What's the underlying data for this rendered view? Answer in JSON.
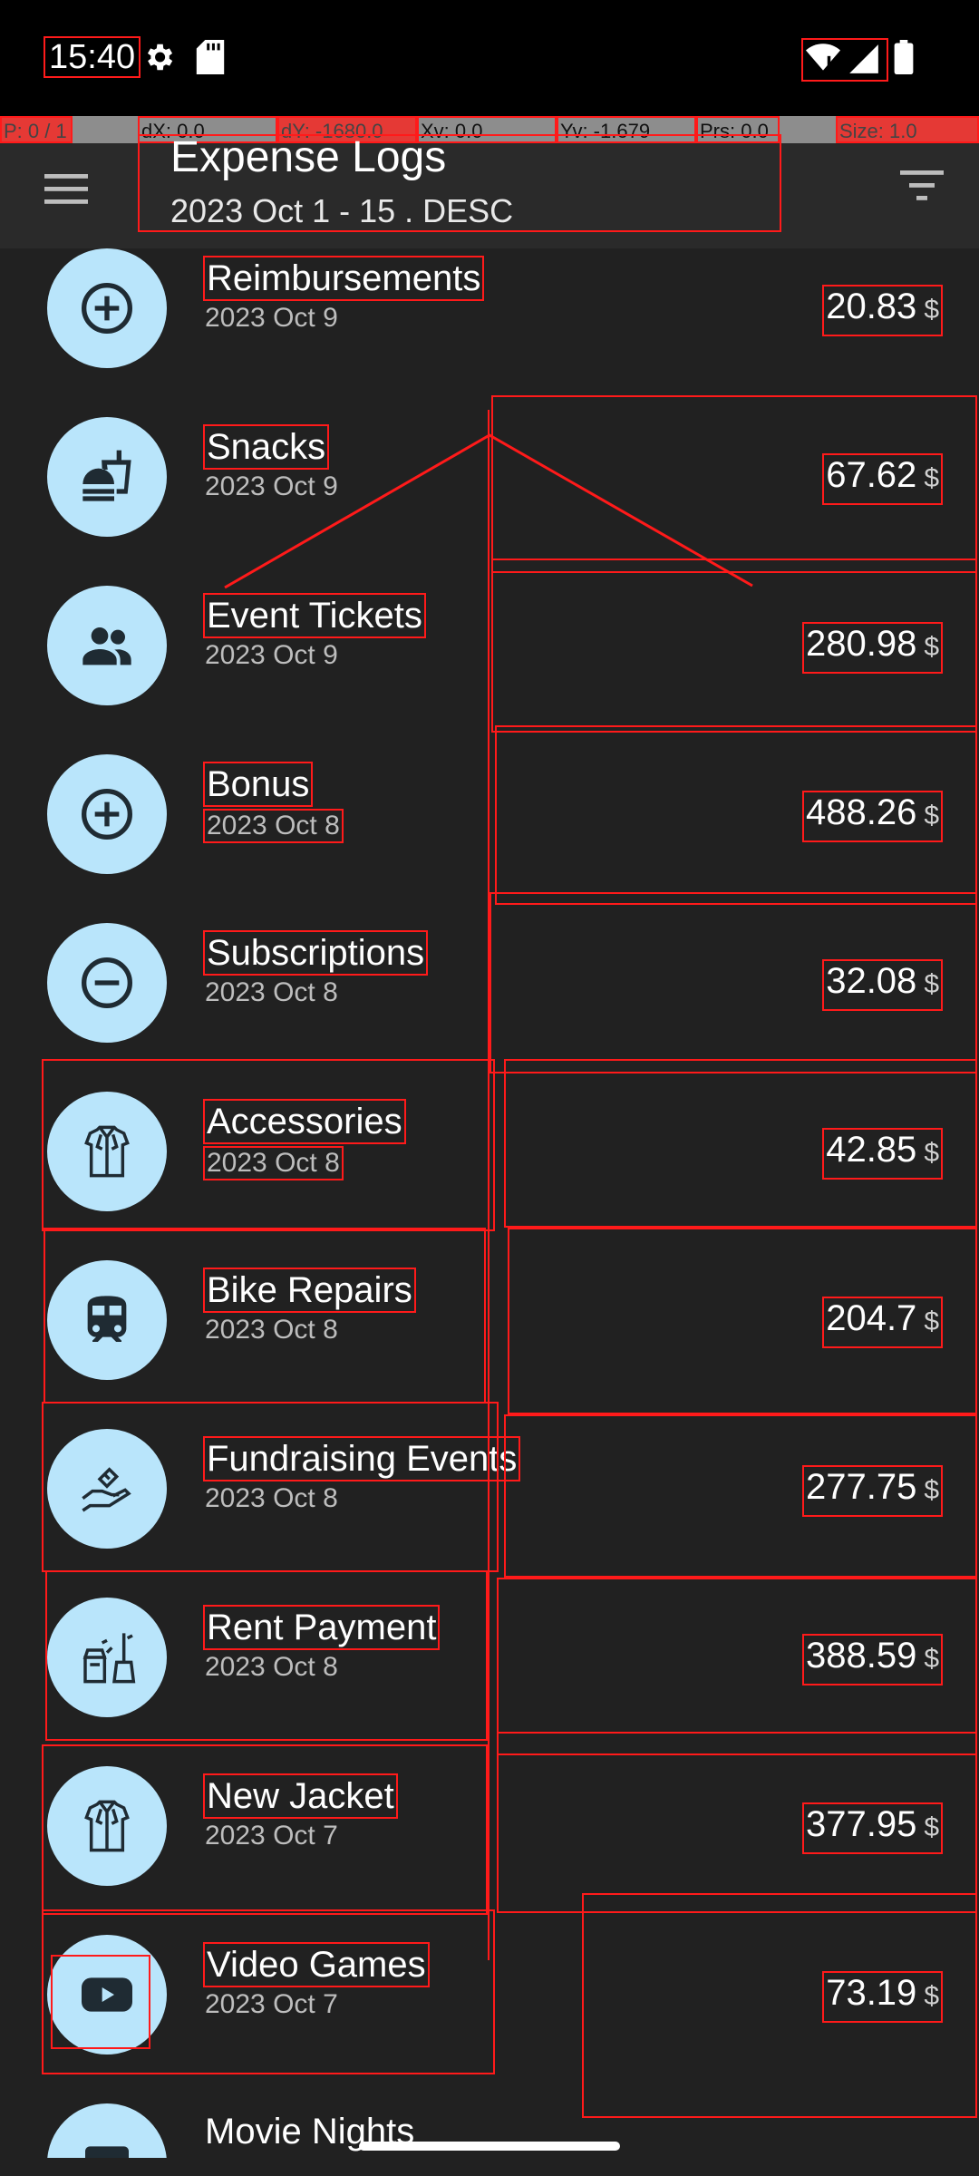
{
  "status_bar": {
    "time": "15:40"
  },
  "debug": {
    "p": "P: 0 / 1",
    "dx": "dX: 0.0",
    "dy": "dY: -1680.0",
    "xv": "Xv: 0.0",
    "yv": "Yv: -1.679",
    "prs": "Prs: 0.0",
    "size": "Size: 1.0"
  },
  "app_bar": {
    "title": "Expense Logs",
    "subtitle": "2023 Oct 1 - 15 . DESC",
    "menu_icon": "menu-icon",
    "filter_icon": "filter-icon"
  },
  "currency": "$",
  "items": [
    {
      "name": "Reimbursements",
      "date": "2023 Oct 9",
      "amount": "20.83",
      "icon": "plus-circle-icon"
    },
    {
      "name": "Snacks",
      "date": "2023 Oct 9",
      "amount": "67.62",
      "icon": "fastfood-icon"
    },
    {
      "name": "Event Tickets",
      "date": "2023 Oct 9",
      "amount": "280.98",
      "icon": "people-icon"
    },
    {
      "name": "Bonus",
      "date": "2023 Oct 8",
      "amount": "488.26",
      "icon": "plus-circle-icon"
    },
    {
      "name": "Subscriptions",
      "date": "2023 Oct 8",
      "amount": "32.08",
      "icon": "minus-circle-icon"
    },
    {
      "name": "Accessories",
      "date": "2023 Oct 8",
      "amount": "42.85",
      "icon": "shirt-icon"
    },
    {
      "name": "Bike Repairs",
      "date": "2023 Oct 8",
      "amount": "204.7",
      "icon": "train-icon"
    },
    {
      "name": "Fundraising Events",
      "date": "2023 Oct 8",
      "amount": "277.75",
      "icon": "donation-hand-icon"
    },
    {
      "name": "Rent Payment",
      "date": "2023 Oct 8",
      "amount": "388.59",
      "icon": "cleaning-tools-icon"
    },
    {
      "name": "New Jacket",
      "date": "2023 Oct 7",
      "amount": "377.95",
      "icon": "shirt-icon"
    },
    {
      "name": "Video Games",
      "date": "2023 Oct 7",
      "amount": "73.19",
      "icon": "youtube-icon"
    },
    {
      "name": "Movie Nights",
      "date": "",
      "amount": "",
      "icon": "movie-icon"
    }
  ],
  "colors": {
    "background": "#212121",
    "avatar": "#b9e5fb",
    "overlay": "#ff1a1a"
  }
}
